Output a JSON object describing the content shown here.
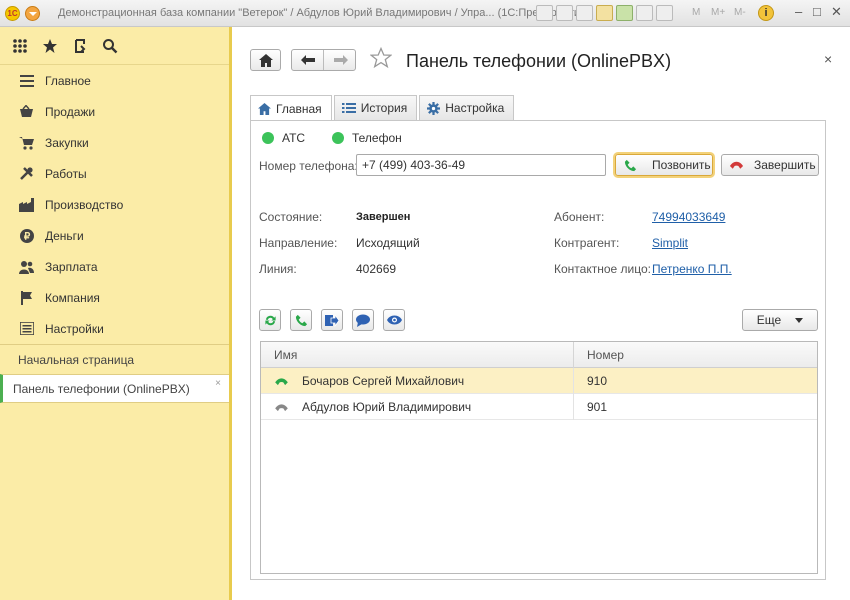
{
  "window": {
    "title": "Демонстрационная база компании \"Ветерок\" / Абдулов Юрий Владимирович / Упра...  (1С:Предприятие)",
    "mem_labels": [
      "M",
      "M+",
      "M-"
    ],
    "logo_text": "1С"
  },
  "sidebar": {
    "tools": [
      "apps-grid-icon",
      "star-icon",
      "history-icon",
      "search-icon"
    ],
    "items": [
      {
        "label": "Главное",
        "icon": "menu-lines-icon"
      },
      {
        "label": "Продажи",
        "icon": "basket-icon"
      },
      {
        "label": "Закупки",
        "icon": "cart-icon"
      },
      {
        "label": "Работы",
        "icon": "tools-icon"
      },
      {
        "label": "Производство",
        "icon": "factory-icon"
      },
      {
        "label": "Деньги",
        "icon": "coin-icon"
      },
      {
        "label": "Зарплата",
        "icon": "people-icon"
      },
      {
        "label": "Компания",
        "icon": "flag-icon"
      },
      {
        "label": "Настройки",
        "icon": "settings-icon"
      }
    ],
    "open_windows": [
      {
        "label": "Начальная страница",
        "active": false
      },
      {
        "label": "Панель телефонии (OnlinePBX)",
        "active": true
      }
    ],
    "close_glyph": "×"
  },
  "form": {
    "title": "Панель телефонии (OnlinePBX)",
    "close_glyph": "×",
    "tabs": [
      {
        "label": "Главная",
        "icon": "home-icon",
        "active": true
      },
      {
        "label": "История",
        "icon": "list-icon",
        "active": false
      },
      {
        "label": "Настройка",
        "icon": "gear-icon",
        "active": false
      }
    ],
    "status": {
      "ats_label": "АТС",
      "phone_label": "Телефон",
      "color": "#3cc35a"
    },
    "phone": {
      "label": "Номер телефона:",
      "value": "+7 (499) 403-36-49"
    },
    "call_button": "Позвонить",
    "end_button": "Завершить",
    "info": {
      "state_label": "Состояние:",
      "state_value": "Завершен",
      "direction_label": "Направление:",
      "direction_value": "Исходящий",
      "line_label": "Линия:",
      "line_value": "402669",
      "subscriber_label": "Абонент:",
      "subscriber_value": "74994033649",
      "counterparty_label": "Контрагент:",
      "counterparty_value": "Simplit",
      "contact_label": "Контактное лицо:",
      "contact_value": "Петренко П.П."
    },
    "more_button": "Еще",
    "grid": {
      "columns": [
        "Имя",
        "Номер"
      ],
      "rows": [
        {
          "name": "Бочаров Сергей Михайлович",
          "number": "910",
          "status_color": "#2aa84a",
          "selected": true
        },
        {
          "name": "Абдулов Юрий Владимирович",
          "number": "901",
          "status_color": "#888888",
          "selected": false
        }
      ]
    }
  }
}
